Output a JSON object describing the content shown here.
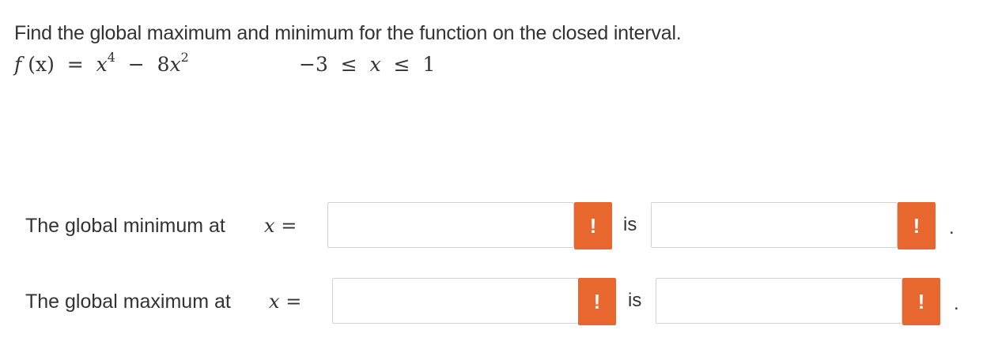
{
  "question": {
    "prompt": "Find the global maximum and minimum for the function on the closed interval."
  },
  "formula": {
    "function_name": "f",
    "function_arg": "(x)",
    "equals": "=",
    "term1_base": "x",
    "term1_exp": "4",
    "minus": "−",
    "term2_coef": "8",
    "term2_base": "x",
    "term2_exp": "2",
    "interval_low": "−3",
    "leq1": "≤",
    "interval_var": "x",
    "leq2": "≤",
    "interval_high": "1"
  },
  "minimum_row": {
    "label": "The global minimum at",
    "var": "x",
    "equals": "=",
    "x_value": "",
    "is_label": "is",
    "f_value": "",
    "warn_symbol": "!",
    "period": "."
  },
  "maximum_row": {
    "label": "The global maximum at",
    "var": "x",
    "equals": "=",
    "x_value": "",
    "is_label": "is",
    "f_value": "",
    "warn_symbol": "!",
    "period": "."
  },
  "colors": {
    "warning": "#e8672f",
    "input_border": "#d2d2d2",
    "text": "#333333"
  }
}
